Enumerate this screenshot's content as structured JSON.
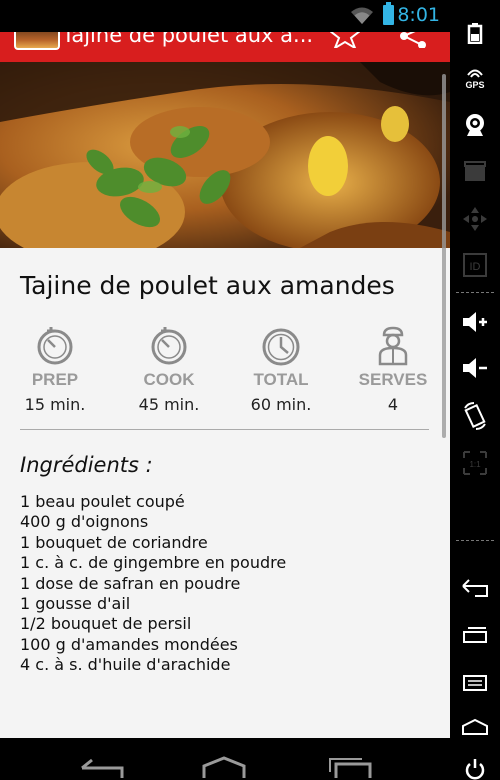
{
  "status_bar": {
    "time": "8:01"
  },
  "action_bar": {
    "title": "Tajine de poulet aux a..."
  },
  "recipe": {
    "title": "Tajine de poulet aux amandes",
    "stats": [
      {
        "label": "PREP",
        "value": "15 min.",
        "icon": "timer-icon"
      },
      {
        "label": "COOK",
        "value": "45 min.",
        "icon": "timer-icon"
      },
      {
        "label": "TOTAL",
        "value": "60 min.",
        "icon": "clock-icon"
      },
      {
        "label": "SERVES",
        "value": "4",
        "icon": "chef-icon"
      }
    ],
    "ingredients_heading": "Ingrédients :",
    "ingredients": [
      "1 beau poulet coupé",
      "400 g d'oignons",
      "1 bouquet de coriandre",
      "1 c. à c. de gingembre en poudre",
      "1 dose de safran en poudre",
      "1 gousse d'ail",
      "1/2 bouquet de persil",
      "100 g d'amandes mondées",
      "4 c. à s. d'huile d'arachide"
    ]
  },
  "emulator_controls": {
    "gps_label": "GPS",
    "id_label": "ID",
    "ratio_label": "1:1"
  },
  "colors": {
    "action_bar": "#d81e1e",
    "status_accent": "#33b5e5",
    "stat_label": "#9a9a9a"
  }
}
